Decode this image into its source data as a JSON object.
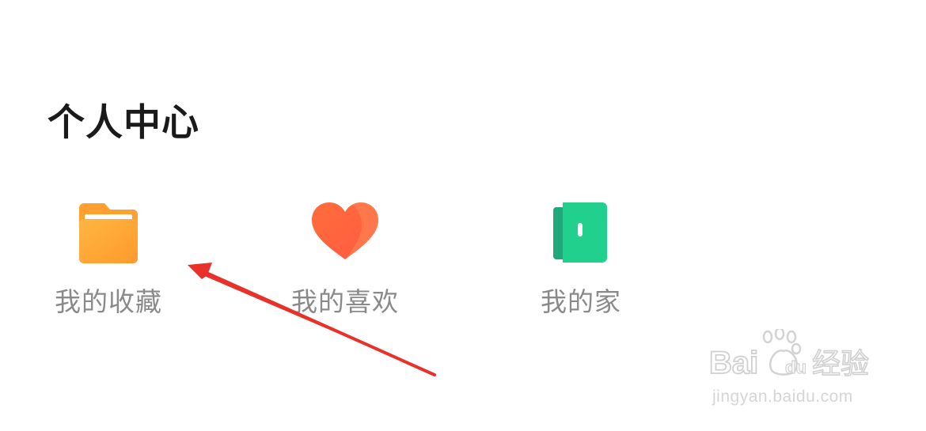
{
  "section": {
    "title": "个人中心"
  },
  "items": [
    {
      "label": "我的收藏",
      "icon": "folder-icon",
      "color": "#FFA532"
    },
    {
      "label": "我的喜欢",
      "icon": "heart-icon",
      "color": "#FF6A3D"
    },
    {
      "label": "我的家",
      "icon": "door-icon",
      "color": "#22C98A"
    }
  ],
  "annotation": {
    "arrow_color": "#E8312A"
  },
  "watermark": {
    "logo_text": "Bai du 经验",
    "url": "jingyan.baidu.com"
  }
}
